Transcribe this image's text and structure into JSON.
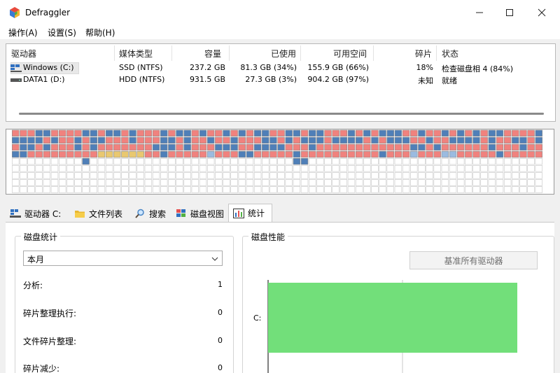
{
  "window": {
    "title": "Defraggler",
    "icon": "defraggler-cube-icon"
  },
  "menu": [
    "操作(A)",
    "设置(S)",
    "帮助(H)"
  ],
  "drive_list": {
    "columns": [
      "驱动器",
      "媒体类型",
      "容量",
      "已使用",
      "可用空间",
      "碎片",
      "状态"
    ],
    "rows": [
      {
        "drive": "Windows (C:)",
        "media": "SSD (NTFS)",
        "capacity": "237.2 GB",
        "used": "81.3 GB (34%)",
        "free": "155.9 GB (66%)",
        "frag": "18%",
        "status": "检查磁盘相 4 (84%)",
        "icon": "windows-drive-icon",
        "selected": true
      },
      {
        "drive": "DATA1 (D:)",
        "media": "HDD (NTFS)",
        "capacity": "931.5 GB",
        "used": "27.3 GB (3%)",
        "free": "904.2 GB (97%)",
        "frag": "未知",
        "status": "就绪",
        "icon": "hard-drive-icon",
        "selected": false
      }
    ]
  },
  "cluster_map": {
    "colors": {
      "empty": "#ffffff",
      "red": "#f0827e",
      "blue": "#4f7fb8",
      "lightblue": "#9bbbe0",
      "yellow": "#e9c870",
      "purple": "#a68bd8"
    },
    "rows": [
      "RRRBBRRRRBBRBBRBRRRBRBBRBRRBRBRBBRRBBRBBRRRBRBRBBBRRBRRBRBRBRBBRRRRBRRRRBRRBRRBB",
      "BBBBRBRRBRBBRRRBRRRBBRBRRBRRBRRRBBRBRBBBRBBBBRBRBBBRRBRRBBBBRBRRBBRBRRBBRBBBRRBB",
      "RBBRBRRRBRBRRRRRRRBBBRBRRRBBBRRBBBBRRRBRRRRRRRRRRRRBBRBRRRRRRBRRRBRRRRRRRRBBBRRRPP",
      "BBRRRRRRRRRYYYYYYRRBRRRRRLRRRBBRRRRRBRRRRRRRRRRBRRRLRRRLLRRRRRBRRRRRLRRRRRRRRRLBRR",
      "EEEEEEEEEBEEEEEEEEEEEEEEEEEEEEEEEEEEBBEEEEEEEEEEEEEEEEEEEEEEEEEEEEEEEEEEEEEEEEEE",
      "EEEEEEEEEEEEEEEEEEEEEEEEEEEEEEEEEEEEEEEEEEEEEEEEEEEEEEEEEEEEEEEEEEEEEEEEEEEEEEEE",
      "EEEEEEEEEEEEEEEEEEEEEEEEEEEEEEEEEEEEEEEEEEEEEEEEEEEEEEEEEEEEEEEEEEEEEEEEEEEEEEEE",
      "EEEEEEEEEEEEEEEEEEEEEEEEEEEEEEEEEEEEEEEEEEEEEEEEEEEEEEEEEEEEEEEEEEEEEEEEEEEEEEEE",
      "EEEEEEEEEEEEEEEEEEEEEEEEEEEEEEEEEEEEEEEEEEEEEEEEEEEEEEEEEEEEEEEEEEEEEBERBERBLBEE"
    ]
  },
  "tabs": [
    {
      "label": "驱动器 C:",
      "icon": "drive-tab-icon"
    },
    {
      "label": "文件列表",
      "icon": "folder-icon"
    },
    {
      "label": "搜索",
      "icon": "magnifier-icon"
    },
    {
      "label": "磁盘视图",
      "icon": "disk-map-icon"
    },
    {
      "label": "统计",
      "icon": "bar-chart-icon",
      "active": true
    }
  ],
  "stats": {
    "group_title": "磁盘统计",
    "period": "本月",
    "items": [
      {
        "label": "分析:",
        "value": "1"
      },
      {
        "label": "碎片整理执行:",
        "value": "0"
      },
      {
        "label": "文件碎片整理:",
        "value": "0"
      },
      {
        "label": "碎片减少:",
        "value": "0"
      }
    ]
  },
  "performance": {
    "group_title": "磁盘性能",
    "benchmark_button": "基准所有驱动器",
    "bar_label": "C:",
    "bar_color": "#72df7a"
  }
}
